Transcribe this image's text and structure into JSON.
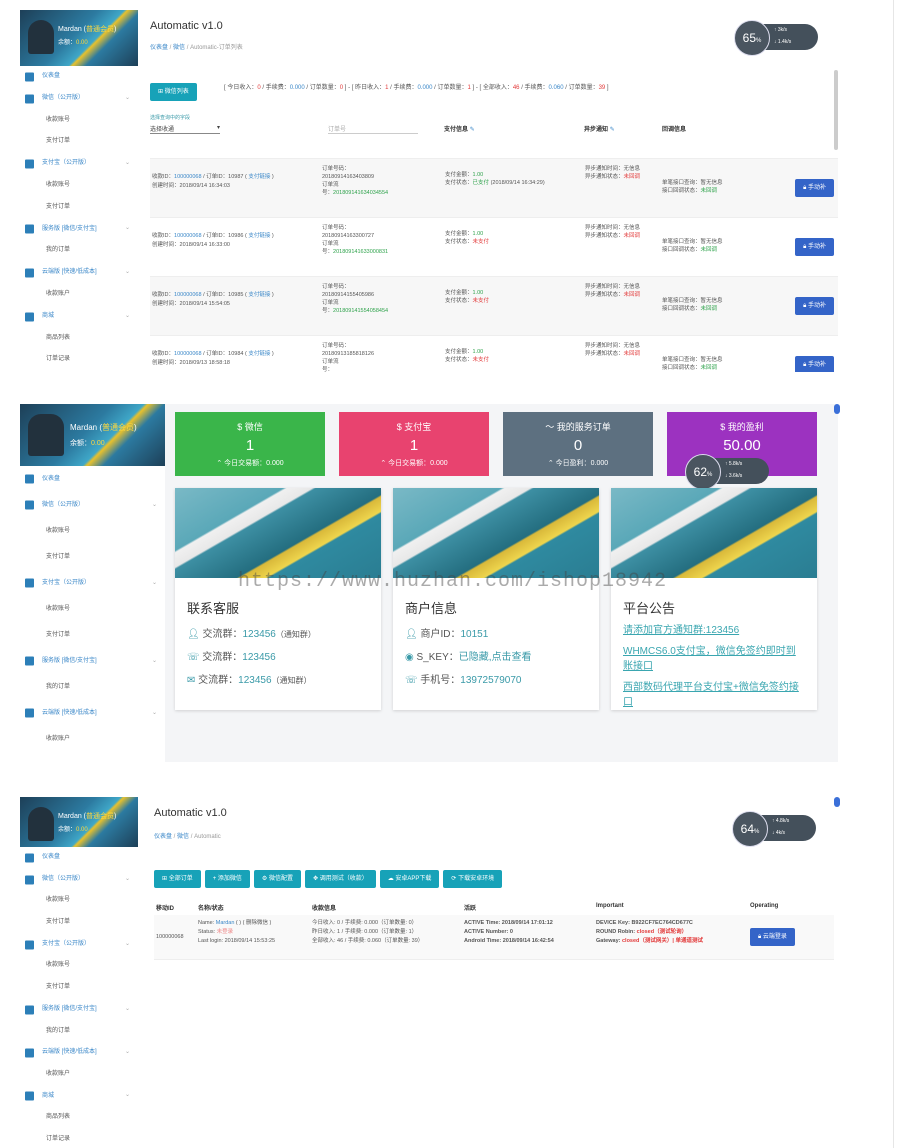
{
  "shared": {
    "app_title": "Automatic v1.0",
    "user_name": "Mardan (",
    "user_level": "普通会员",
    "user_name_close": ")",
    "balance_label": "余额：",
    "balance": "0.00"
  },
  "panel1": {
    "breadcrumb": [
      "仪表盘",
      "微信",
      "Automatic-订单列表"
    ],
    "gauge": {
      "value": "65",
      "unit": "%",
      "up": "3k/s",
      "down": "1.4k/s"
    },
    "sidebar": [
      {
        "type": "top",
        "label": "仪表盘",
        "icon": "dashboard-icon"
      },
      {
        "type": "top",
        "label": "微信（公开版）",
        "icon": "wechat-icon",
        "chev": "⌄"
      },
      {
        "type": "sub",
        "label": "收款账号"
      },
      {
        "type": "sub",
        "label": "支付订单"
      },
      {
        "type": "top",
        "label": "支付宝（公开版）",
        "icon": "alipay-icon",
        "chev": "⌄"
      },
      {
        "type": "sub",
        "label": "收款账号"
      },
      {
        "type": "sub",
        "label": "支付订单"
      },
      {
        "type": "top",
        "label": "服务版 [微信/支付宝]",
        "icon": "service-icon",
        "chev": "⌄"
      },
      {
        "type": "sub",
        "label": "我的订单"
      },
      {
        "type": "top",
        "label": "云端版 [快速/低成本]",
        "icon": "cloud-icon",
        "chev": "⌄"
      },
      {
        "type": "sub",
        "label": "收款账户"
      },
      {
        "type": "top",
        "label": "商城",
        "icon": "cart-icon",
        "chev": "⌄"
      },
      {
        "type": "sub",
        "label": "商品列表"
      },
      {
        "type": "sub",
        "label": "订单记录"
      }
    ],
    "order_list_button": "微信列表",
    "stats": {
      "today_income_label": "[ 今日收入：",
      "today_income": "0",
      "today_fee_label": " / 手续费：",
      "today_fee": "0.000",
      "today_count_label": " / 订单数量：",
      "today_count": "0",
      "yesterday_income_label": " ] - [ 昨日收入：",
      "yesterday_income": "1",
      "yesterday_fee_label": " / 手续费：",
      "yesterday_fee": "0.000",
      "yesterday_count_label": " / 订单数量：",
      "yesterday_count": "1",
      "total_income_label": " ] - [ 全部收入：",
      "total_income": "46",
      "total_fee_label": " / 手续费：",
      "total_fee": "0.060",
      "total_count_label": " / 订单数量：",
      "total_count": "39",
      "close": " ]"
    },
    "filter": {
      "select_hint": "选择查询中的字段",
      "select_value": "选择收通",
      "order_placeholder": "订单号",
      "col_paid": "支付信息",
      "col_notify": "异步通知",
      "col_callback": "回调信息"
    },
    "rows": [
      {
        "account_id": "100000068",
        "order_id": "10987",
        "paylink": "支付链接",
        "created": "2018/09/14 16:34:03",
        "order_no": "20180914163403809",
        "stream_no": "201809141634034554",
        "paid": "1.00",
        "status": "已支付",
        "paid_time": "(2018/09/14 16:34:29)",
        "notify_time": "无信息",
        "notify_status": "未回调",
        "inter": "暂无信息",
        "inter_status": "未回调",
        "action": "手动补"
      },
      {
        "account_id": "100000068",
        "order_id": "10986",
        "paylink": "支付链接",
        "created": "2018/09/14 16:33:00",
        "order_no": "20180914163300727",
        "stream_no": "201809141633000831",
        "paid": "1.00",
        "status": "未支付",
        "paid_time": "",
        "notify_time": "无信息",
        "notify_status": "未回调",
        "inter": "暂无信息",
        "inter_status": "未回调",
        "action": "手动补"
      },
      {
        "account_id": "100000068",
        "order_id": "10985",
        "paylink": "支付链接",
        "created": "2018/09/14 15:54:05",
        "order_no": "20180914155405986",
        "stream_no": "201809141554058454",
        "paid": "1.00",
        "status": "未支付",
        "paid_time": "",
        "notify_time": "无信息",
        "notify_status": "未回调",
        "inter": "暂无信息",
        "inter_status": "未回调",
        "action": "手动补"
      },
      {
        "account_id": "100000068",
        "order_id": "10984",
        "paylink": "支付链接",
        "created": "2018/09/13 18:58:18",
        "order_no": "20180913185818126",
        "stream_no": "",
        "paid": "1.00",
        "status": "未支付",
        "paid_time": "",
        "notify_time": "无信息",
        "notify_status": "未回调",
        "inter": "暂无信息",
        "inter_status": "未回调",
        "action": "手动补"
      }
    ]
  },
  "panel2": {
    "gauge": {
      "value": "62",
      "unit": "%",
      "up": "5.8k/s",
      "down": "3.6k/s"
    },
    "sidebar": [
      {
        "type": "top",
        "label": "仪表盘",
        "icon": "dashboard-icon"
      },
      {
        "type": "top",
        "label": "微信（公开版）",
        "icon": "wechat-icon",
        "chev": "⌄"
      },
      {
        "type": "sub",
        "label": "收款账号"
      },
      {
        "type": "sub",
        "label": "支付订单"
      },
      {
        "type": "top",
        "label": "支付宝（公开版）",
        "icon": "alipay-icon",
        "chev": "⌄"
      },
      {
        "type": "sub",
        "label": "收款账号"
      },
      {
        "type": "sub",
        "label": "支付订单"
      },
      {
        "type": "top",
        "label": "服务版 [微信/支付宝]",
        "icon": "service-icon",
        "chev": "⌄"
      },
      {
        "type": "sub",
        "label": "我的订单"
      },
      {
        "type": "top",
        "label": "云端版 [快速/低成本]",
        "icon": "cloud-icon",
        "chev": "⌄"
      },
      {
        "type": "sub",
        "label": "收款账户"
      }
    ],
    "tiles": [
      {
        "title": "$ 微信",
        "value": "1",
        "sub": "今日交易额：0.000",
        "color": "#3ab54a"
      },
      {
        "title": "$ 支付宝",
        "value": "1",
        "sub": "今日交易额：0.000",
        "color": "#e8436f"
      },
      {
        "title": "〜 我的服务订单",
        "value": "0",
        "sub": "今日盈利：0.000",
        "color": "#5d7080"
      },
      {
        "title": "$ 我的盈利",
        "value": "50.00",
        "sub": "账户余额",
        "color": "#9c32c0"
      }
    ],
    "contact": {
      "title": "联系客服",
      "lines": [
        {
          "icon": "group-icon",
          "label": "交流群：",
          "value": "123456",
          "suffix": "（通知群）"
        },
        {
          "icon": "phone-icon",
          "label": "交流群：",
          "value": "123456",
          "suffix": ""
        },
        {
          "icon": "mail-icon",
          "label": "交流群：",
          "value": "123456",
          "suffix": "（通知群）"
        }
      ]
    },
    "merchant": {
      "title": "商户信息",
      "lines": [
        {
          "icon": "user-icon",
          "label": "商户ID：",
          "value": "10151"
        },
        {
          "icon": "eye-icon",
          "label": "S_KEY：",
          "value": "已隐藏,点击查看"
        },
        {
          "icon": "phone-icon",
          "label": "手机号：",
          "value": "13972579070"
        }
      ]
    },
    "announce": {
      "title": "平台公告",
      "items": [
        "请添加官方通知群:123456",
        "WHMCS6.0支付宝，微信免签约即时到账接口",
        "西部数码代理平台支付宝+微信免签约接口"
      ]
    },
    "watermark": "https://www.huzhan.com/ishop18942"
  },
  "panel3": {
    "breadcrumb": [
      "仪表盘",
      "微信",
      "Automatic"
    ],
    "gauge": {
      "value": "64",
      "unit": "%",
      "up": "4.8k/s",
      "down": "4k/s"
    },
    "sidebar": [
      {
        "type": "top",
        "label": "仪表盘",
        "icon": "dashboard-icon"
      },
      {
        "type": "top",
        "label": "微信（公开版）",
        "icon": "wechat-icon",
        "chev": "⌄"
      },
      {
        "type": "sub",
        "label": "收款账号"
      },
      {
        "type": "sub",
        "label": "支付订单"
      },
      {
        "type": "top",
        "label": "支付宝（公开版）",
        "icon": "alipay-icon",
        "chev": "⌄"
      },
      {
        "type": "sub",
        "label": "收款账号"
      },
      {
        "type": "sub",
        "label": "支付订单"
      },
      {
        "type": "top",
        "label": "服务版 [微信/支付宝]",
        "icon": "service-icon",
        "chev": "⌄"
      },
      {
        "type": "sub",
        "label": "我的订单"
      },
      {
        "type": "top",
        "label": "云端版 [快速/低成本]",
        "icon": "cloud-icon",
        "chev": "⌄"
      },
      {
        "type": "sub",
        "label": "收款账户"
      },
      {
        "type": "top",
        "label": "商城",
        "icon": "cart-icon",
        "chev": "⌄"
      },
      {
        "type": "sub",
        "label": "商品列表"
      },
      {
        "type": "sub",
        "label": "订单记录"
      }
    ],
    "toolbar": [
      {
        "icon": "grid-icon",
        "label": "全部订单"
      },
      {
        "icon": "plus-icon",
        "label": "添加微信"
      },
      {
        "icon": "gear-icon",
        "label": "微信配置"
      },
      {
        "icon": "move-icon",
        "label": "调用测试（收款）"
      },
      {
        "icon": "cloud-download-icon",
        "label": "安卓APP下载"
      },
      {
        "icon": "refresh-icon",
        "label": "下载安卓环境"
      }
    ],
    "headers": [
      "移动ID",
      "名称/状态",
      "收款信息",
      "活跃",
      "Important",
      "Operating"
    ],
    "row": {
      "id": "100000068",
      "name_label": "Name: ",
      "name": "Mardan",
      "name_suffix": " ( ) ( 删除微信 )",
      "status_label": "Status: ",
      "status": "未登录",
      "login_label": "Last login: ",
      "login": "2018/09/14 15:53:25",
      "today": "今日收入: 0 / 手续费: 0.000（订单数量: 0）",
      "yesterday": "昨日收入: 1 / 手续费: 0.000（订单数量: 1）",
      "total": "全部收入: 46 / 手续费: 0.060（订单数量: 39）",
      "active_time": "ACTIVE Time: 2018/09/14 17:01:12",
      "active_num": "ACTIVE Number: 0",
      "android_time": "Android Time: 2018/09/14 16:42:54",
      "device": "DEVICE Key: B922CF7EC764CD677C",
      "robin_label": "ROUND Robin: ",
      "robin": "closed（测试轮询）",
      "gateway_label": "Gateway: ",
      "gateway": "closed（测试网关）| 单通道测试",
      "action": "云端登录"
    }
  }
}
